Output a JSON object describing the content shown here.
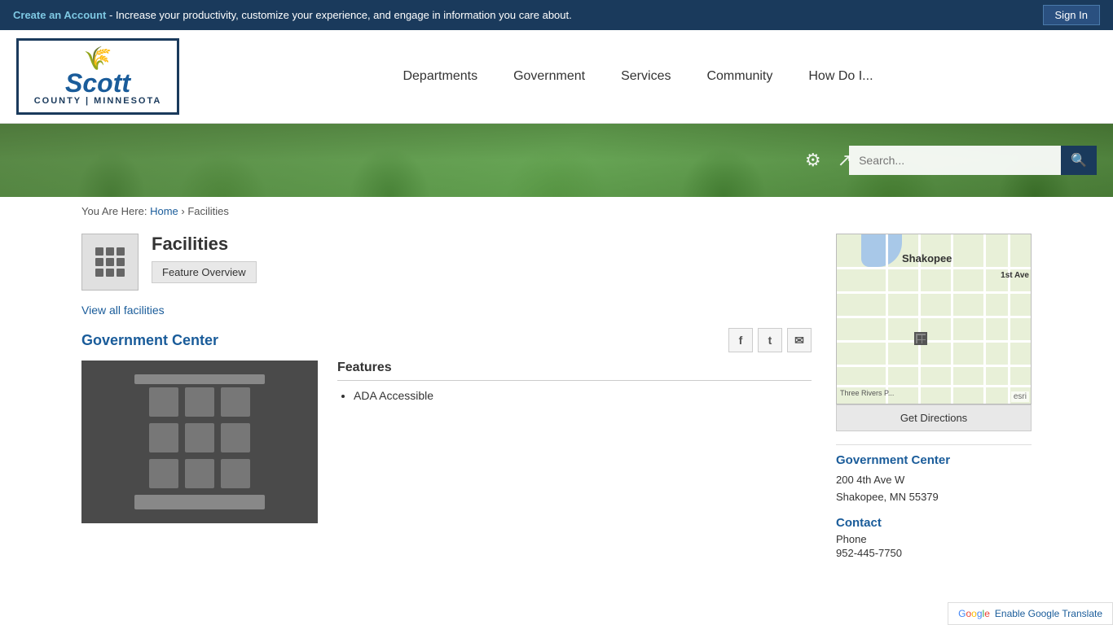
{
  "topbar": {
    "create_account_label": "Create an Account",
    "create_account_desc": " - Increase your productivity, customize your experience, and engage in information you care about.",
    "sign_in_label": "Sign In"
  },
  "header": {
    "logo": {
      "icon": "🌿",
      "name": "Scott",
      "sub": "COUNTY | MINNESOTA"
    },
    "nav": [
      {
        "id": "departments",
        "label": "Departments"
      },
      {
        "id": "government",
        "label": "Government"
      },
      {
        "id": "services",
        "label": "Services"
      },
      {
        "id": "community",
        "label": "Community"
      },
      {
        "id": "how-do-i",
        "label": "How Do I..."
      }
    ],
    "search_placeholder": "Search..."
  },
  "breadcrumb": {
    "you_are_here": "You Are Here: ",
    "home": "Home",
    "separator": " › ",
    "current": "Facilities"
  },
  "page": {
    "facility_title": "Facilities",
    "feature_overview_btn": "Feature Overview",
    "view_all_link": "View all facilities",
    "card": {
      "title": "Government Center",
      "image_alt": "Government Center Building",
      "features_title": "Features",
      "features": [
        "ADA Accessible"
      ],
      "social": {
        "facebook": "f",
        "twitter": "🐦",
        "email": "✉"
      }
    }
  },
  "sidebar": {
    "get_directions": "Get Directions",
    "location_title": "Government Center",
    "address_line1": "200 4th Ave W",
    "address_line2": "Shakopee, MN 55379",
    "contact_title": "Contact",
    "phone_label": "Phone",
    "phone": "952-445-7750",
    "map": {
      "label_shakopee": "Shakopee",
      "label_1st_ave": "1st Ave",
      "label_three_rivers": "Three Rivers P...",
      "label_esri": "esri"
    }
  },
  "translate": {
    "enable_label": "Enable Google Translate"
  }
}
